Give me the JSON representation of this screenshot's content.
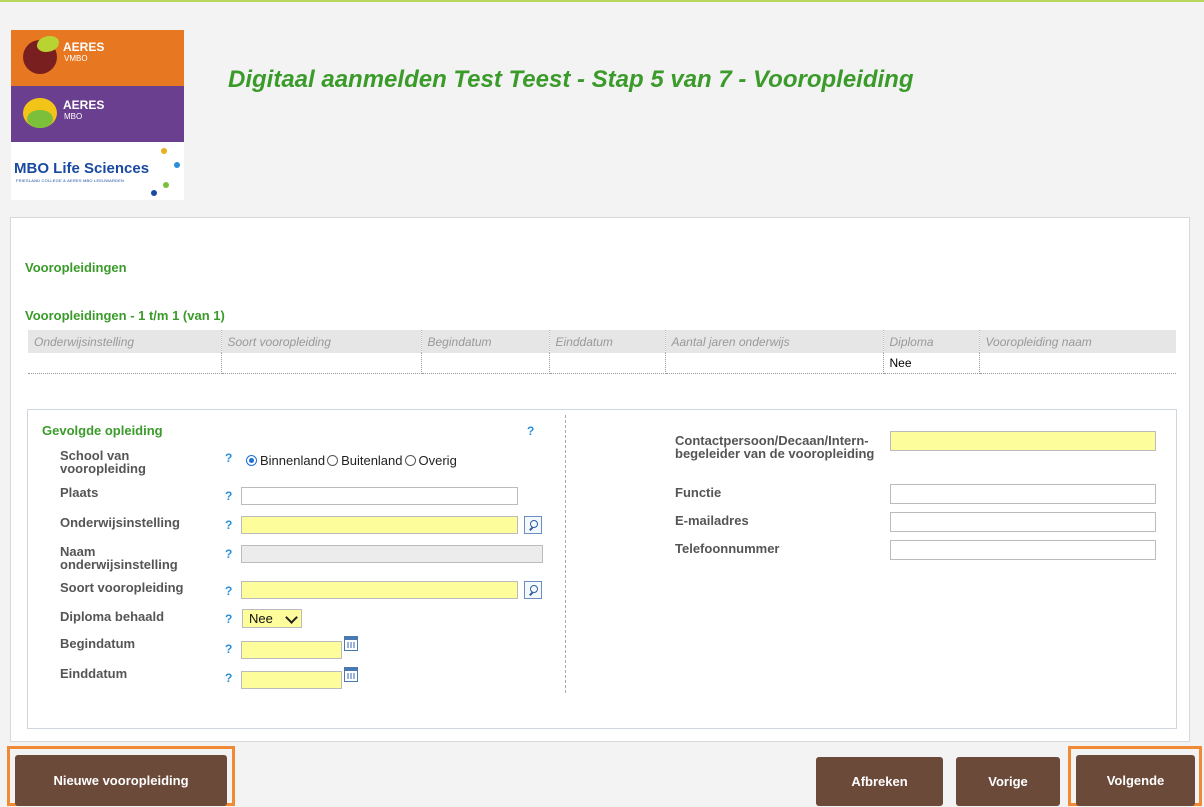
{
  "header": {
    "title": "Digitaal aanmelden Test Teest  - Stap 5 van 7 - Vooropleiding"
  },
  "logos": {
    "vmbo": {
      "name": "AERES",
      "sub": "VMBO"
    },
    "mbo": {
      "name": "AERES",
      "sub": "MBO"
    },
    "mls": {
      "name": "MBO Life Sciences",
      "sub": "FRIESLAND COLLEGE & AERES MBO LEEUWARDEN"
    }
  },
  "section": {
    "title": "Vooropleidingen",
    "list_title": "Vooropleidingen - 1 t/m 1 (van 1)"
  },
  "table": {
    "columns": [
      "Onderwijsinstelling",
      "Soort vooropleiding",
      "Begindatum",
      "Einddatum",
      "Aantal jaren onderwijs",
      "Diploma",
      "Vooropleiding naam"
    ],
    "rows": [
      [
        "",
        "",
        "",
        "",
        "",
        "Nee",
        ""
      ]
    ]
  },
  "form": {
    "heading": "Gevolgde opleiding",
    "help": "?",
    "school_label": "School van vooropleiding",
    "radio_options": [
      "Binnenland",
      "Buitenland",
      "Overig"
    ],
    "radio_selected": "Binnenland",
    "plaats_label": "Plaats",
    "onderwijsinstelling_label": "Onderwijsinstelling",
    "naam_label": "Naam onderwijsinstelling",
    "soort_label": "Soort vooropleiding",
    "diploma_label": "Diploma behaald",
    "diploma_value": "Nee",
    "begindatum_label": "Begindatum",
    "einddatum_label": "Einddatum",
    "contact_label": "Contactpersoon/Decaan/Intern-begeleider van de vooropleiding",
    "functie_label": "Functie",
    "email_label": "E-mailadres",
    "telefoon_label": "Telefoonnummer"
  },
  "buttons": {
    "nieuwe": "Nieuwe vooropleiding",
    "afbreken": "Afbreken",
    "vorige": "Vorige",
    "volgende": "Volgende"
  },
  "colors": {
    "accent_green": "#3b9b2a",
    "button_brown": "#6b4a3a",
    "highlight_orange": "#f08a35",
    "required_yellow": "#fdfd9c"
  }
}
